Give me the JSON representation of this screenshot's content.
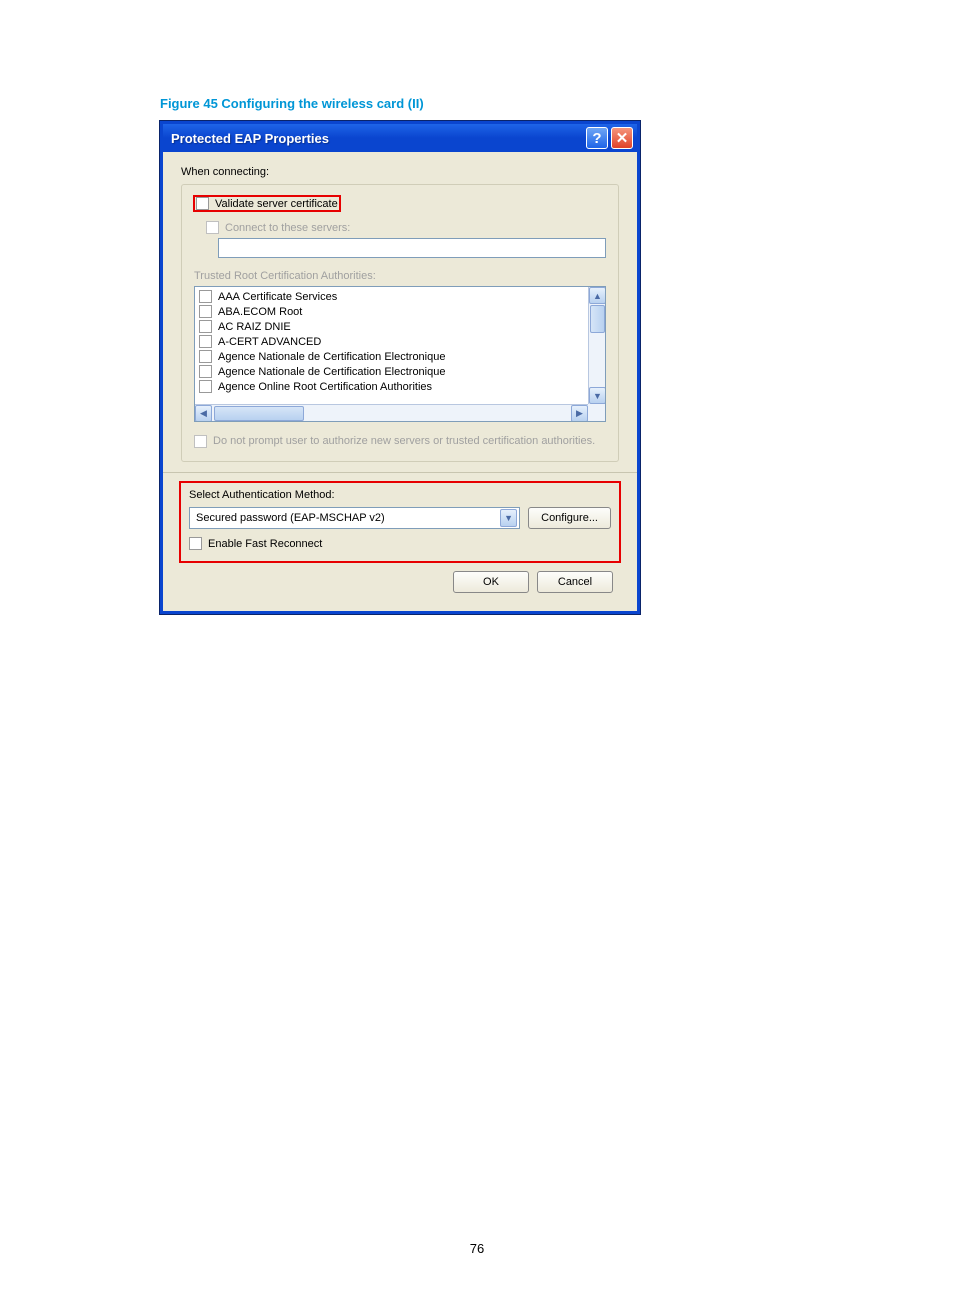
{
  "figure_caption": "Figure 45 Configuring the wireless card (II)",
  "dialog": {
    "title": "Protected EAP Properties",
    "when_connecting_label": "When connecting:",
    "validate_server_certificate_label": "Validate server certificate",
    "connect_to_servers_label": "Connect to these servers:",
    "trusted_root_label": "Trusted Root Certification Authorities:",
    "authorities": [
      "AAA Certificate Services",
      "ABA.ECOM Root",
      "AC RAIZ DNIE",
      "A-CERT ADVANCED",
      "Agence Nationale de Certification Electronique",
      "Agence Nationale de Certification Electronique",
      "Agence Online Root Certification Authorities"
    ],
    "do_not_prompt_label": "Do not prompt user to authorize new servers or trusted certification authorities.",
    "select_auth_method_label": "Select Authentication Method:",
    "auth_method_value": "Secured password (EAP-MSCHAP v2)",
    "configure_button": "Configure...",
    "enable_fast_reconnect_label": "Enable Fast Reconnect",
    "ok_button": "OK",
    "cancel_button": "Cancel"
  },
  "page_number": "76"
}
